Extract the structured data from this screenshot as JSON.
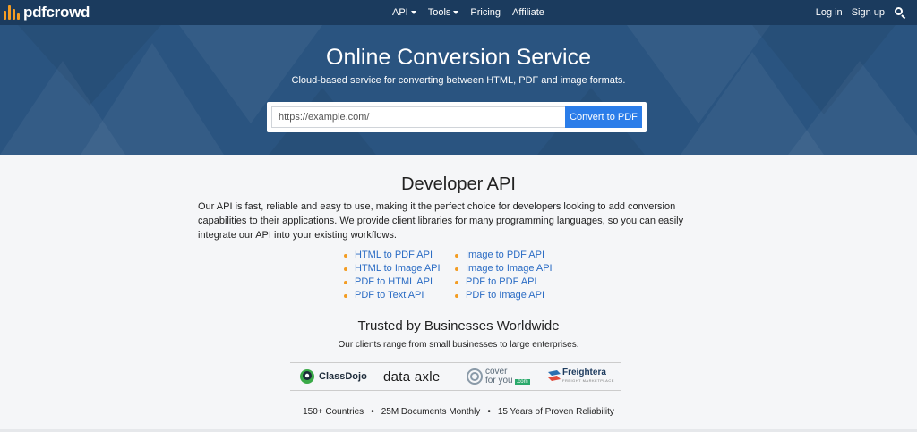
{
  "navbar": {
    "brand": "pdfcrowd",
    "links": [
      {
        "label": "API",
        "dropdown": true
      },
      {
        "label": "Tools",
        "dropdown": true
      },
      {
        "label": "Pricing",
        "dropdown": false
      },
      {
        "label": "Affiliate",
        "dropdown": false
      }
    ],
    "login": "Log in",
    "signup": "Sign up",
    "search_icon": "search-icon"
  },
  "hero": {
    "title": "Online Conversion Service",
    "subtitle": "Cloud-based service for converting between HTML, PDF and image formats.",
    "url_placeholder": "https://example.com/",
    "convert_button": "Convert to PDF"
  },
  "developer": {
    "heading": "Developer API",
    "description": "Our API is fast, reliable and easy to use, making it the perfect choice for developers looking to add conversion capabilities to their applications. We provide client libraries for many programming languages, so you can easily integrate our API into your existing workflows.",
    "api_links_left": [
      "HTML to PDF API",
      "HTML to Image API",
      "PDF to HTML API",
      "PDF to Text API"
    ],
    "api_links_right": [
      "Image to PDF API",
      "Image to Image API",
      "PDF to PDF API",
      "PDF to Image API"
    ]
  },
  "trust": {
    "heading": "Trusted by Businesses Worldwide",
    "subtitle": "Our clients range from small businesses to large enterprises.",
    "logos": {
      "classdojo": "ClassDojo",
      "dataaxle": "data axle",
      "coverforyou_top": "cover",
      "coverforyou_bottom": "for you",
      "coverforyou_badge": ".com",
      "freightera": "Freightera",
      "freightera_tagline": "FREIGHT MARKETPLACE"
    },
    "stats": [
      "150+ Countries",
      "25M Documents Monthly",
      "15 Years of Proven Reliability"
    ],
    "stats_separator": "•"
  },
  "colors": {
    "navbar": "#1b3b5e",
    "hero": "#2a5480",
    "accent_orange": "#f39c23",
    "link_blue": "#2b6cc4",
    "button_blue": "#2b7de9"
  }
}
